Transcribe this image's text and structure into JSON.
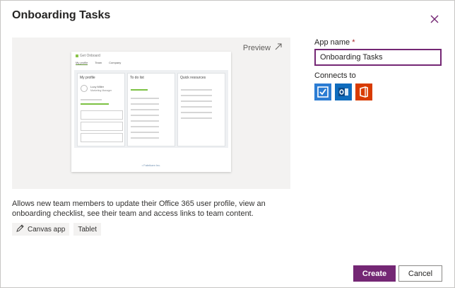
{
  "dialog": {
    "title": "Onboarding Tasks",
    "close_icon": "close-icon"
  },
  "preview": {
    "link_label": "Preview",
    "link_icon": "open-external-icon",
    "thumbnail": {
      "app_header": "Get Onboard",
      "tabs": [
        "My profile",
        "Team",
        "Company"
      ],
      "columns": [
        "My profile",
        "To do list",
        "Quick resources"
      ],
      "profile_name": "Lucy Miller",
      "profile_role": "Marketing Manager",
      "footer": "• Fabrikam Inc."
    }
  },
  "description": "Allows new team members to update their Office 365 user profile, view an onboarding checklist, see their team and access links to team content.",
  "tags": [
    {
      "label": "Canvas app",
      "icon": "pencil-icon"
    },
    {
      "label": "Tablet"
    }
  ],
  "form": {
    "app_name_label": "App name",
    "required_marker": "*",
    "app_name_value": "Onboarding Tasks",
    "connects_to_label": "Connects to",
    "connectors": [
      {
        "name": "Planner",
        "icon": "planner-icon",
        "color": "#2b7cd3"
      },
      {
        "name": "Outlook",
        "icon": "outlook-icon",
        "color": "#0f6cbd"
      },
      {
        "name": "Office 365",
        "icon": "office-icon",
        "color": "#d83b01"
      }
    ]
  },
  "footer": {
    "create_label": "Create",
    "cancel_label": "Cancel"
  },
  "colors": {
    "accent": "#742774",
    "preview_bg": "#f3f2f1"
  }
}
